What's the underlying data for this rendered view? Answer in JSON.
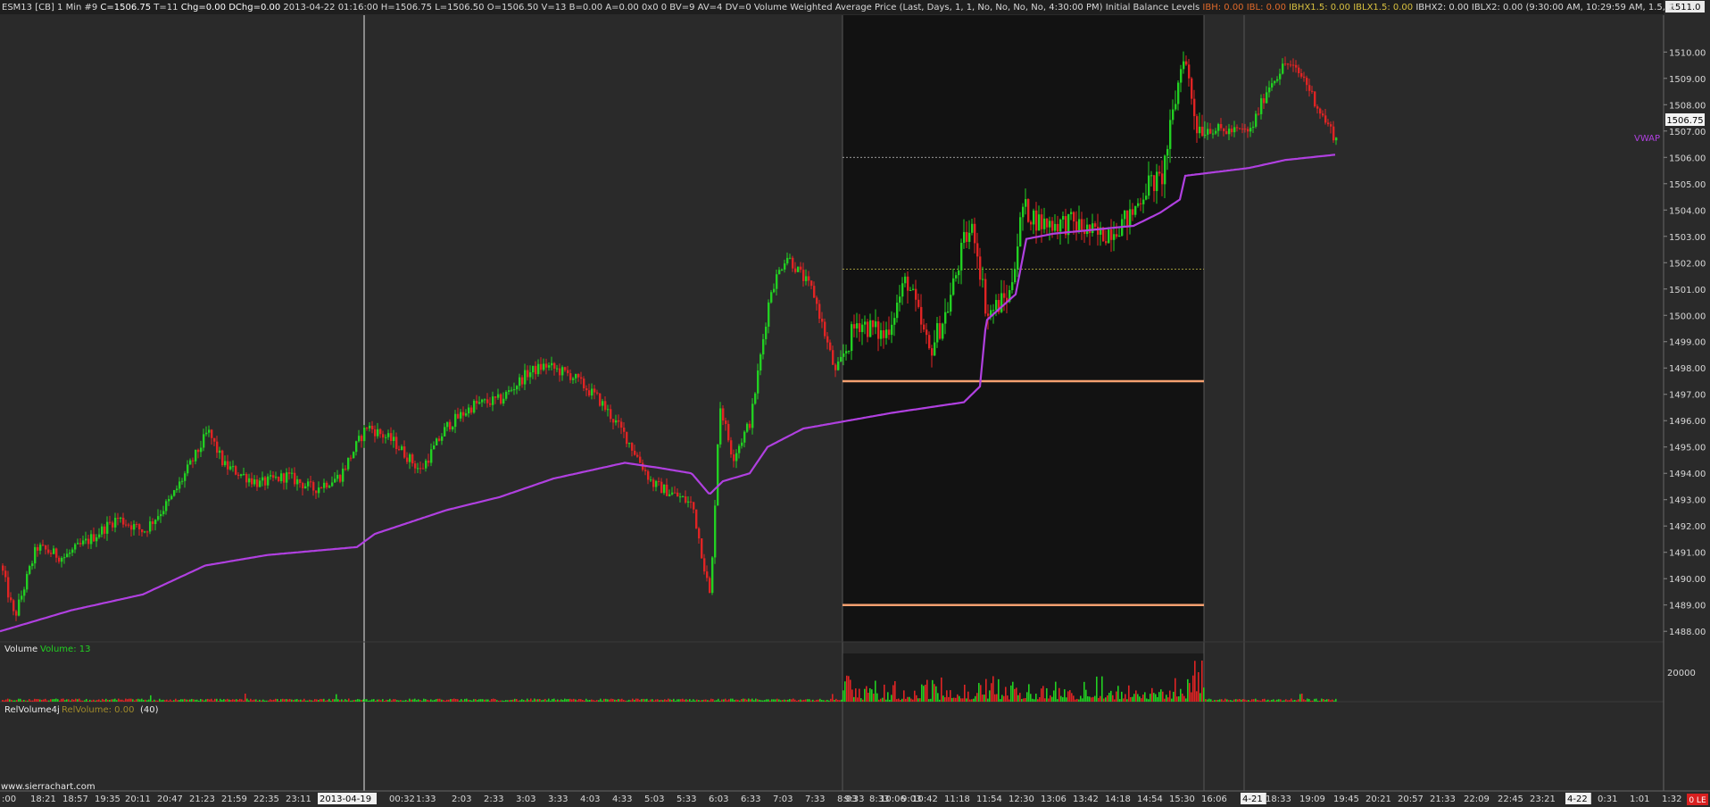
{
  "header": {
    "symbol": "ESM13 [CB]",
    "timeframe": "1 Min",
    "bar_num": "#9",
    "close": "C=1506.75",
    "ticks": "T=11",
    "chg": "Chg=0.00",
    "dchg": "DChg=0.00",
    "datetime": "2013-04-22 01:16:00",
    "ohlc": "H=1506.75 L=1506.50 O=1506.50 V=13 B=0.00 A=0.00 0x0 0 BV=9 AV=4 DV=0",
    "vwap_study": "Volume Weighted Average Price (Last, Days, 1, 1, No, No, No, No, 4:30:00 PM)",
    "ib_study": "Initial Balance Levels",
    "ib_values": [
      {
        "text": "IBH: 0.00",
        "color": "#e06a2a"
      },
      {
        "text": "IBL: 0.00",
        "color": "#e06a2a"
      },
      {
        "text": "IBHX1.5: 0.00",
        "color": "#d8c040"
      },
      {
        "text": "IBLX1.5: 0.00",
        "color": "#d8c040"
      },
      {
        "text": "IBHX2: 0.00",
        "color": "#d8d8d8"
      },
      {
        "text": "IBLX2: 0.00",
        "color": "#d8d8d8"
      },
      {
        "text": "(9:30:00 AM, 10:29:59 AM, 1.5, 2",
        "color": "#d8d8d8"
      }
    ]
  },
  "colors": {
    "background": "#2a2a2a",
    "session_bg": "#121212",
    "up": "#22d022",
    "down": "#e02424",
    "vwap": "#b040e0",
    "ib_line": "#f4a070",
    "ib_ext": "#c8c048",
    "ib_ext2": "#c8c8c8"
  },
  "price_axis": {
    "ticks": [
      "1510.00",
      "1509.00",
      "1508.00",
      "1507.00",
      "1506.00",
      "1505.00",
      "1504.00",
      "1503.00",
      "1502.00",
      "1501.00",
      "1500.00",
      "1499.00",
      "1498.00",
      "1497.00",
      "1496.00",
      "1495.00",
      "1494.00",
      "1493.00",
      "1492.00",
      "1491.00",
      "1490.00",
      "1489.00",
      "1488.00"
    ],
    "top_value": "1511.0",
    "current_price": "1506.75",
    "vwap_label": "VWAP"
  },
  "volume_panel": {
    "title": "Volume",
    "value_label": "Volume: 13",
    "axis_label": "20000"
  },
  "relvol_panel": {
    "title": "RelVolume4j",
    "value_label": "RelVolume: 0.00",
    "period": "(40)"
  },
  "time_axis": {
    "labels": [
      ":00",
      "18:21",
      "18:57",
      "19:35",
      "20:11",
      "20:47",
      "21:23",
      "21:59",
      "22:35",
      "23:11",
      "2013-04-19",
      "00:32",
      "1:33",
      "2:03",
      "2:33",
      "3:03",
      "3:33",
      "4:03",
      "4:33",
      "5:03",
      "5:33",
      "6:03",
      "6:33",
      "7:03",
      "7:33",
      "8:03",
      "8:33",
      "9:03",
      "9:33",
      "10:06",
      "10:42",
      "11:18",
      "11:54",
      "12:30",
      "13:06",
      "13:42",
      "14:18",
      "14:54",
      "15:30",
      "16:06",
      "4-21",
      "18:33",
      "19:09",
      "19:45",
      "20:21",
      "20:57",
      "21:33",
      "22:09",
      "22:45",
      "23:21",
      "4-22",
      "0:31",
      "1:01",
      "1:32"
    ]
  },
  "footer": {
    "watermark": "www.sierrachart.com",
    "status": "0 LE"
  },
  "chart_data": {
    "type": "candlestick",
    "title": "",
    "ylim": [
      1487.6,
      1511.4
    ],
    "ib_high": 1497.5,
    "ib_low": 1489.0,
    "ib_ext_high_1_5": 1501.75,
    "ib_ext_high_2": 1506.0,
    "current_price": 1506.75,
    "price_path": [
      [
        0,
        1490.5
      ],
      [
        15,
        1488.5
      ],
      [
        40,
        1491.2
      ],
      [
        70,
        1490.8
      ],
      [
        100,
        1491.5
      ],
      [
        130,
        1492.3
      ],
      [
        160,
        1491.8
      ],
      [
        190,
        1493.0
      ],
      [
        220,
        1494.8
      ],
      [
        232,
        1495.6
      ],
      [
        250,
        1494.3
      ],
      [
        290,
        1493.6
      ],
      [
        320,
        1493.9
      ],
      [
        350,
        1493.4
      ],
      [
        380,
        1493.9
      ],
      [
        410,
        1495.8
      ],
      [
        440,
        1495.2
      ],
      [
        470,
        1494.1
      ],
      [
        500,
        1495.8
      ],
      [
        530,
        1496.6
      ],
      [
        560,
        1496.8
      ],
      [
        590,
        1497.8
      ],
      [
        610,
        1498.1
      ],
      [
        640,
        1497.7
      ],
      [
        670,
        1496.8
      ],
      [
        700,
        1495.4
      ],
      [
        730,
        1493.6
      ],
      [
        760,
        1493.1
      ],
      [
        775,
        1492.8
      ],
      [
        795,
        1489.2
      ],
      [
        805,
        1496.7
      ],
      [
        820,
        1494.6
      ],
      [
        840,
        1496.0
      ],
      [
        862,
        1500.9
      ],
      [
        880,
        1502.3
      ],
      [
        910,
        1500.9
      ],
      [
        935,
        1497.8
      ],
      [
        960,
        1499.8
      ],
      [
        990,
        1499.2
      ],
      [
        1015,
        1501.4
      ],
      [
        1040,
        1498.6
      ],
      [
        1060,
        1500.2
      ],
      [
        1080,
        1502.9
      ],
      [
        1090,
        1503.3
      ],
      [
        1105,
        1500.0
      ],
      [
        1130,
        1500.8
      ],
      [
        1145,
        1504.1
      ],
      [
        1165,
        1503.5
      ],
      [
        1200,
        1503.5
      ],
      [
        1230,
        1503.0
      ],
      [
        1265,
        1503.7
      ],
      [
        1285,
        1505.0
      ],
      [
        1300,
        1505.1
      ],
      [
        1310,
        1507.0
      ],
      [
        1325,
        1510.0
      ],
      [
        1340,
        1507.2
      ],
      [
        1370,
        1507.0
      ],
      [
        1400,
        1507.0
      ],
      [
        1420,
        1508.7
      ],
      [
        1440,
        1509.6
      ],
      [
        1460,
        1509.0
      ],
      [
        1480,
        1507.6
      ],
      [
        1496,
        1506.7
      ]
    ],
    "vwap_path": [
      [
        0,
        1488.0
      ],
      [
        80,
        1488.8
      ],
      [
        160,
        1489.4
      ],
      [
        230,
        1490.5
      ],
      [
        300,
        1490.9
      ],
      [
        400,
        1491.2
      ],
      [
        420,
        1491.7
      ],
      [
        500,
        1492.6
      ],
      [
        560,
        1493.1
      ],
      [
        620,
        1493.8
      ],
      [
        700,
        1494.4
      ],
      [
        740,
        1494.2
      ],
      [
        775,
        1494.0
      ],
      [
        795,
        1493.2
      ],
      [
        810,
        1493.7
      ],
      [
        840,
        1494.0
      ],
      [
        860,
        1495.0
      ],
      [
        900,
        1495.7
      ],
      [
        1000,
        1496.3
      ],
      [
        1080,
        1496.7
      ],
      [
        1098,
        1497.3
      ],
      [
        1105,
        1499.8
      ],
      [
        1138,
        1500.8
      ],
      [
        1150,
        1502.9
      ],
      [
        1180,
        1503.1
      ],
      [
        1270,
        1503.4
      ],
      [
        1300,
        1503.9
      ],
      [
        1322,
        1504.4
      ],
      [
        1328,
        1505.3
      ],
      [
        1400,
        1505.6
      ],
      [
        1440,
        1505.9
      ],
      [
        1496,
        1506.1
      ]
    ]
  }
}
